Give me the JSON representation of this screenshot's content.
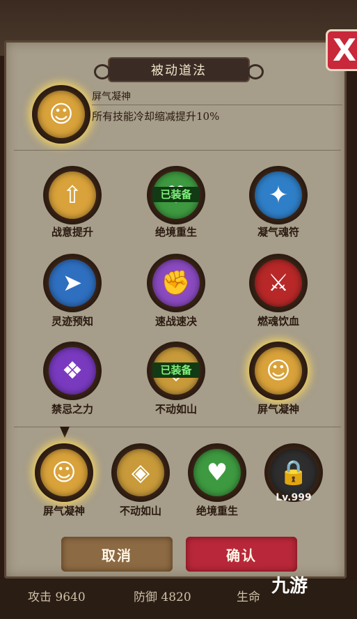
{
  "title": "被动道法",
  "close_label": "X",
  "selected": {
    "name": "屏气凝神",
    "description": "所有技能冷却缩减提升10%"
  },
  "equipped_badge": "已装备",
  "skills": [
    {
      "name": "战意提升",
      "icon": "flame-arrow-icon",
      "color": "#d9a23a"
    },
    {
      "name": "绝境重生",
      "icon": "heart-plus-icon",
      "color": "#3e9a40"
    },
    {
      "name": "凝气魂符",
      "icon": "talisman-icon",
      "color": "#2f7fc8"
    },
    {
      "name": "灵迹预知",
      "icon": "dash-figure-icon",
      "color": "#2f6fc0"
    },
    {
      "name": "速战速决",
      "icon": "fist-icon",
      "color": "#8a4ac0"
    },
    {
      "name": "燃魂饮血",
      "icon": "blood-blade-icon",
      "color": "#b82828"
    },
    {
      "name": "禁忌之力",
      "icon": "forbidden-book-icon",
      "color": "#7a3ac0"
    },
    {
      "name": "不动如山",
      "icon": "shield-icon",
      "color": "#c89a3a"
    },
    {
      "name": "屏气凝神",
      "icon": "meditation-icon",
      "color": "#d9a23a"
    }
  ],
  "slots": [
    {
      "name": "屏气凝神",
      "icon": "meditation-icon",
      "color": "#d9a23a"
    },
    {
      "name": "不动如山",
      "icon": "shield-icon",
      "color": "#c89a3a"
    },
    {
      "name": "绝境重生",
      "icon": "heart-plus-icon",
      "color": "#3e9a40"
    },
    {
      "lock_label": "Lv.999",
      "icon": "lock-icon"
    }
  ],
  "buttons": {
    "cancel": "取消",
    "confirm": "确认"
  },
  "stats": {
    "attack": "攻击 9640",
    "defense": "防御 4820",
    "hp": "生命"
  },
  "brand": "九游"
}
